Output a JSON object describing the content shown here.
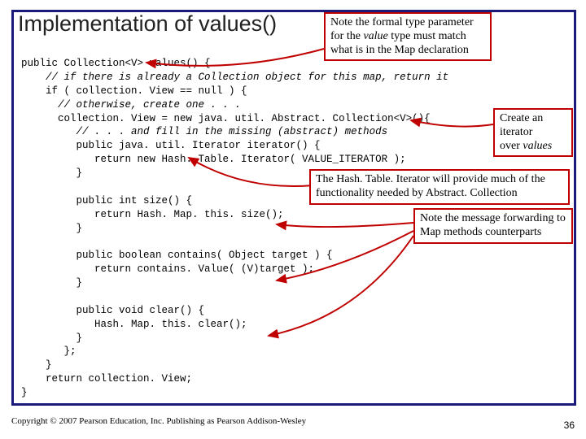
{
  "title": "Implementation of values()",
  "code": {
    "l1": "public Collection<V> values() {",
    "l2": "    // if there is already a Collection object for this map, return it",
    "l3": "    if ( collection. View == null ) {",
    "l4": "      // otherwise, create one . . .",
    "l5": "      collection. View = new java. util. Abstract. Collection<V>(){",
    "l6": "         // . . . and fill in the missing (abstract) methods",
    "l7": "         public java. util. Iterator iterator() {",
    "l8": "            return new Hash. Table. Iterator( VALUE_ITERATOR );",
    "l9": "         }",
    "l10": "",
    "l11": "         public int size() {",
    "l12": "            return Hash. Map. this. size();",
    "l13": "         }",
    "l14": "",
    "l15": "         public boolean contains( Object target ) {",
    "l16": "            return contains. Value( (V)target );",
    "l17": "         }",
    "l18": "",
    "l19": "         public void clear() {",
    "l20": "            Hash. Map. this. clear();",
    "l21": "         }",
    "l22": "       };",
    "l23": "    }",
    "l24": "    return collection. View;",
    "l25": "}"
  },
  "annot1a": "Note the formal type parameter",
  "annot1b_pre": "for the ",
  "annot1b_it": "value",
  "annot1b_post": " type must match",
  "annot1c": "what is in the Map declaration",
  "annot2a": "Create an iterator",
  "annot2b_pre": "over ",
  "annot2b_it": "values",
  "annot3": "The Hash. Table. Iterator will provide much of the functionality needed by Abstract. Collection",
  "annot4": "Note the message forwarding to Map methods counterparts",
  "footer": "Copyright © 2007 Pearson Education, Inc. Publishing as Pearson Addison-Wesley",
  "page": "36"
}
